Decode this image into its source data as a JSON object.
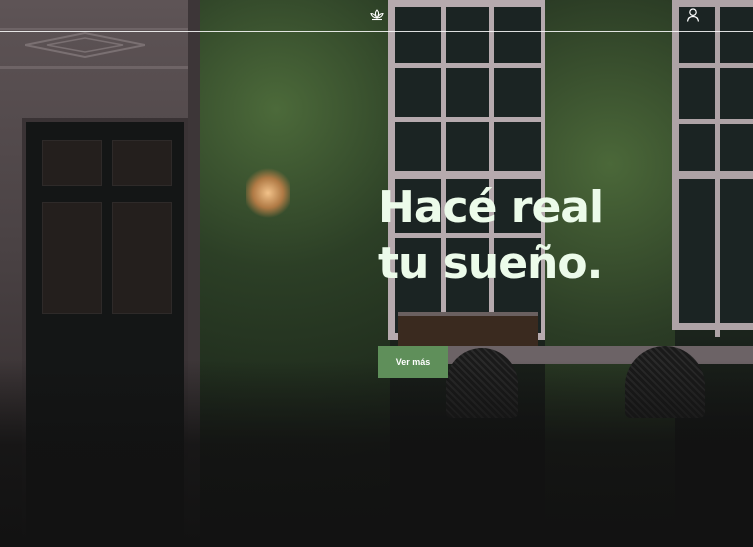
{
  "header": {
    "logo_icon": "lotus-icon",
    "account_icon": "user-icon"
  },
  "hero": {
    "headline_line1": "Hacé real",
    "headline_line2": "tu sueño.",
    "cta_label": "Ver más"
  },
  "colors": {
    "headline": "#ecfbea",
    "cta_background": "#5f8f5a",
    "header_line": "#ffffff"
  }
}
